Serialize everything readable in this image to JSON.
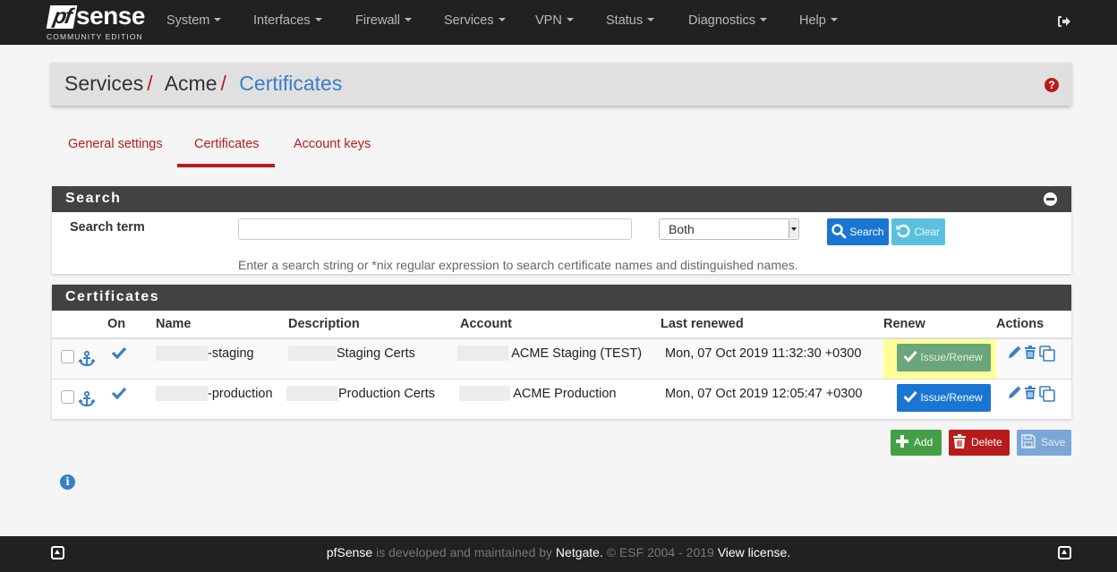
{
  "navbar": {
    "logo_pf": "pf",
    "logo_sense": "sense",
    "logo_edition": "COMMUNITY EDITION",
    "menu": [
      "System",
      "Interfaces",
      "Firewall",
      "Services",
      "VPN",
      "Status",
      "Diagnostics",
      "Help"
    ],
    "logout_icon": "sign-out-icon"
  },
  "breadcrumb": {
    "items": [
      "Services",
      "Acme",
      "Certificates"
    ],
    "separator": "/",
    "help_icon": "question-circle-icon"
  },
  "tabs": [
    {
      "label": "General settings",
      "active": false
    },
    {
      "label": "Certificates",
      "active": true
    },
    {
      "label": "Account keys",
      "active": false
    }
  ],
  "search_panel": {
    "title": "Search",
    "term_label": "Search term",
    "term_value": "",
    "scope_selected": "Both",
    "search_button": "Search",
    "clear_button": "Clear",
    "hint": "Enter a search string or *nix regular expression to search certificate names and distinguished names."
  },
  "certificates_panel": {
    "title": "Certificates",
    "columns": [
      "",
      "On",
      "Name",
      "Description",
      "Account",
      "Last renewed",
      "Renew",
      "Actions"
    ],
    "rows": [
      {
        "enabled": true,
        "name": "-staging",
        "description": "Staging Certs",
        "account": "ACME Staging (TEST)",
        "last_renewed": "Mon, 07 Oct 2019 11:32:30 +0300",
        "renew_label": "Issue/Renew",
        "renew_state": "disabled-highlighted"
      },
      {
        "enabled": true,
        "name": "-production",
        "description": "Production Certs",
        "account": "ACME Production",
        "last_renewed": "Mon, 07 Oct 2019 12:05:47 +0300",
        "renew_label": "Issue/Renew",
        "renew_state": "primary"
      }
    ]
  },
  "buttons": {
    "add": "Add",
    "delete": "Delete",
    "save": "Save"
  },
  "colors": {
    "accent_red": "#b71c1c",
    "primary_blue": "#1976d2",
    "link_blue": "#3a7fc4",
    "success_green": "#43a047",
    "navbar_bg": "#212121",
    "panel_heading_bg": "#424242"
  },
  "footer": {
    "brand": "pfSense",
    "text1": " is developed and maintained by ",
    "company": "Netgate.",
    "text2": " © ESF 2004 - 2019 ",
    "license_link": "View license."
  }
}
